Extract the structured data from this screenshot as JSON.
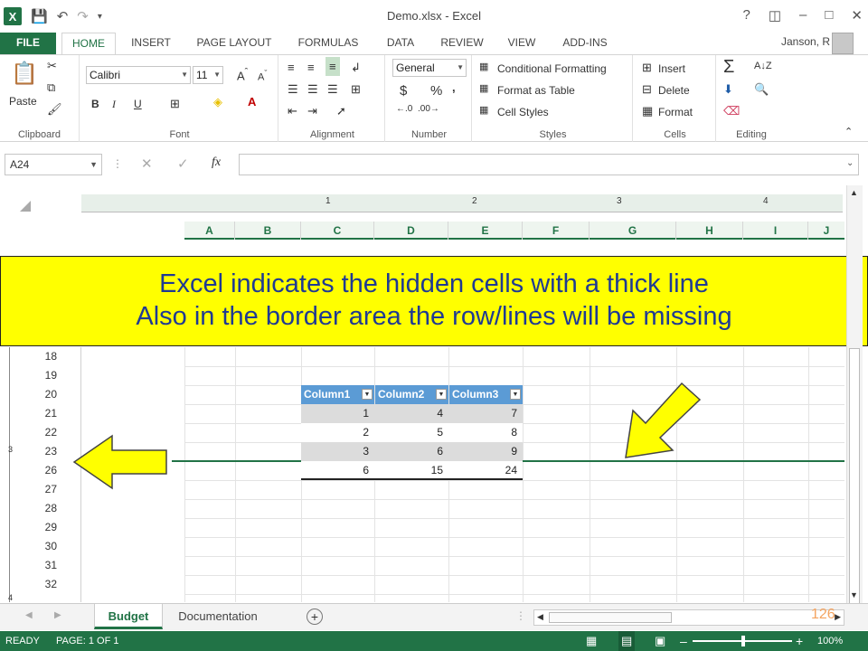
{
  "window": {
    "title": "Demo.xlsx - Excel"
  },
  "qat": {
    "logo": "X",
    "icons": [
      "save-icon",
      "undo-icon",
      "redo-icon",
      "customize-icon"
    ]
  },
  "tabs": [
    "FILE",
    "HOME",
    "INSERT",
    "PAGE LAYOUT",
    "FORMULAS",
    "DATA",
    "REVIEW",
    "VIEW",
    "ADD-INS"
  ],
  "user": {
    "name": "Janson, R"
  },
  "ribbon": {
    "clipboard": {
      "label": "Clipboard",
      "paste": "Paste"
    },
    "font": {
      "label": "Font",
      "family": "Calibri",
      "size": "11",
      "bold": "B",
      "italic": "I",
      "underline": "U"
    },
    "alignment": {
      "label": "Alignment"
    },
    "number": {
      "label": "Number",
      "format": "General",
      "currency": "$",
      "percent": "%"
    },
    "styles": {
      "label": "Styles",
      "conditional": "Conditional Formatting",
      "format_table": "Format as Table",
      "cell_styles": "Cell Styles"
    },
    "cells": {
      "label": "Cells",
      "insert": "Insert",
      "delete": "Delete",
      "format": "Format"
    },
    "editing": {
      "label": "Editing"
    }
  },
  "formula_bar": {
    "name_box": "A24",
    "fx": "fx",
    "value": ""
  },
  "ruler": {
    "marks": [
      "1",
      "2",
      "3",
      "4"
    ]
  },
  "columns": [
    "A",
    "B",
    "C",
    "D",
    "E",
    "F",
    "G",
    "H",
    "I",
    "J"
  ],
  "rows": [
    "18",
    "19",
    "20",
    "21",
    "22",
    "23",
    "26",
    "27",
    "28",
    "29",
    "30",
    "31",
    "32"
  ],
  "outline": {
    "level3": "3",
    "level4": "4"
  },
  "callout": {
    "line1": "Excel indicates the hidden cells with a thick line",
    "line2": "Also in the border area the row/lines will be missing"
  },
  "table": {
    "headers": [
      "Column1",
      "Column2",
      "Column3"
    ],
    "rows": [
      [
        "1",
        "4",
        "7"
      ],
      [
        "2",
        "5",
        "8"
      ],
      [
        "3",
        "6",
        "9"
      ]
    ],
    "totals": [
      "6",
      "15",
      "24"
    ]
  },
  "sheets": {
    "active": "Budget",
    "other": "Documentation",
    "add": "+"
  },
  "status": {
    "ready": "READY",
    "page": "PAGE: 1 OF 1",
    "zoom": "100%",
    "slide_number": "126"
  },
  "colors": {
    "excel_green": "#217346",
    "callout_yellow": "#ffff00",
    "callout_text": "#1f3a93",
    "table_header": "#5b9bd5",
    "banded_row": "#dcdcdc",
    "slide_number": "#f4a460"
  }
}
